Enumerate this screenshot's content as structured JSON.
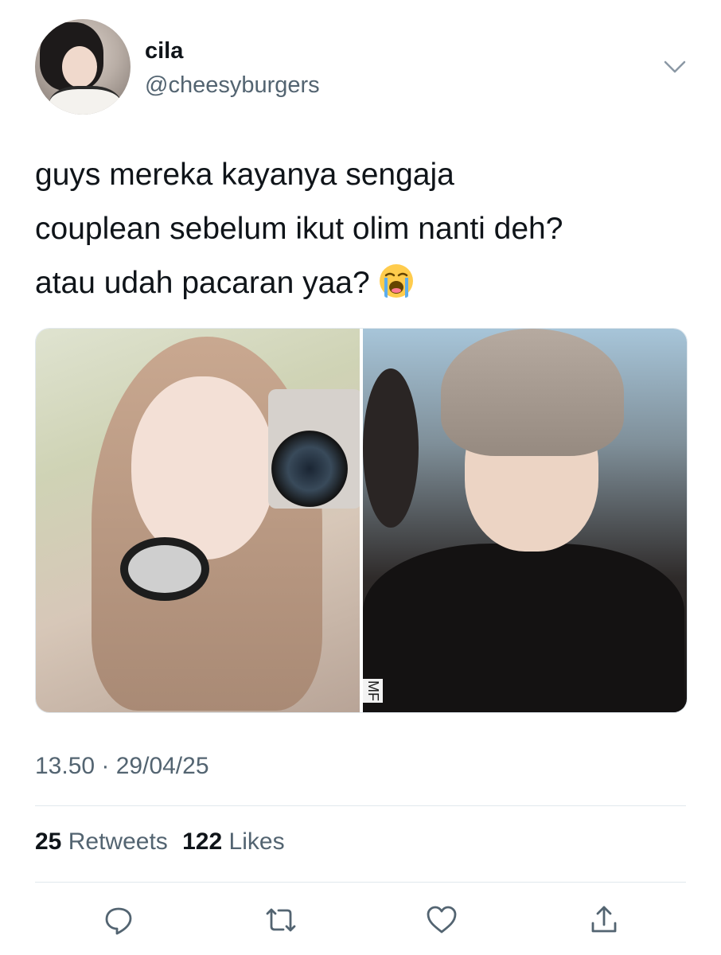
{
  "user": {
    "display_name": "cila",
    "handle": "@cheesyburgers"
  },
  "tweet": {
    "lines": [
      "guys mereka kayanya sengaja",
      "couplean sebelum ikut olim nanti deh?",
      "atau udah pacaran yaa?"
    ],
    "emoji": "loudly-crying-face",
    "media_watermark": "MF"
  },
  "timestamp": "13.50 · 29/04/25",
  "stats": {
    "retweets_count": "25",
    "retweets_label": "Retweets",
    "likes_count": "122",
    "likes_label": "Likes"
  },
  "actions": [
    "reply-icon",
    "retweet-icon",
    "like-icon",
    "share-icon"
  ],
  "colors": {
    "text": "#0f1419",
    "secondary": "#536471",
    "divider": "#e1e8ed",
    "icon": "#536471"
  }
}
